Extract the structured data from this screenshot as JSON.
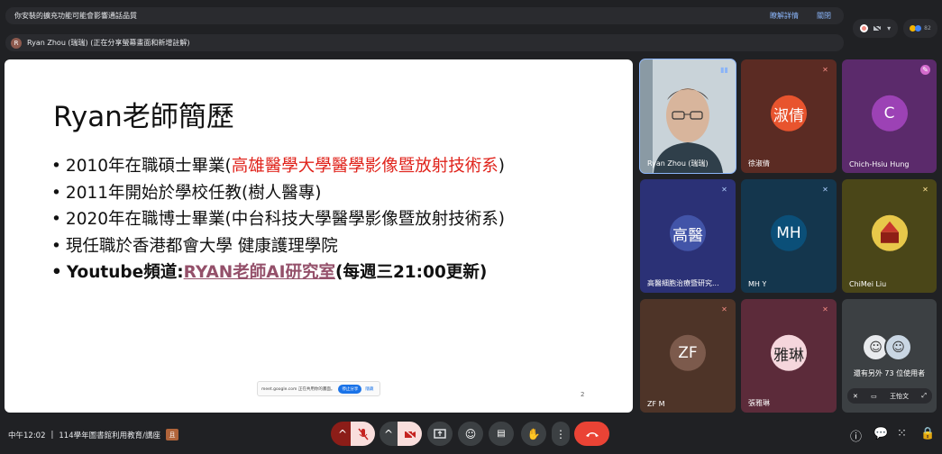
{
  "banner": {
    "text": "你安裝的擴充功能可能會影響通話品質",
    "learn_more": "瞭解詳情",
    "close": "關閉"
  },
  "share_bar": {
    "avatar_letter": "R",
    "text": "Ryan Zhou (瑞瑞) (正在分享螢幕畫面和新增註解)"
  },
  "top_right": {
    "people_count": "82"
  },
  "slide": {
    "title": "Ryan老師簡歷",
    "bullets": [
      {
        "prefix": "2010年在職碩士畢業(",
        "red": "高雄醫學大學醫學影像暨放射技術系",
        "suffix": ")"
      },
      {
        "text": "2011年開始於學校任教(樹人醫專)"
      },
      {
        "text": "2020年在職博士畢業(中台科技大學醫學影像暨放射技術系)"
      },
      {
        "text": "現任職於香港都會大學  健康護理學院"
      },
      {
        "prefix": "Youtube頻道:",
        "link": "RYAN老師AI研究室",
        "suffix": "(每週三21:00更新)"
      }
    ],
    "page_number": "2",
    "popup": {
      "text": "meet.google.com 正在共用你的畫面。",
      "stop": "停止分享",
      "hide": "隱藏"
    }
  },
  "participants": [
    {
      "name": "Ryan Zhou (瑞瑞)",
      "bg": "#b8c4cc",
      "speaking": true
    },
    {
      "name": "徐淑倩",
      "initials": "淑倩",
      "bg": "#5b2b23",
      "av": "#e8542e"
    },
    {
      "name": "Chich-Hsiu Hung",
      "initials": "C",
      "bg": "#5b2a6b",
      "av": "#9c42b5"
    },
    {
      "name": "高醫細胞治療暨研究...",
      "initials": "高醫",
      "bg": "#2b3176",
      "av": "#4254a8"
    },
    {
      "name": "MH Y",
      "initials": "MH",
      "bg": "#14364d",
      "av": "#0b4f78"
    },
    {
      "name": "ChiMei Liu",
      "bg": "#4a4618",
      "av": "#e8c84a"
    },
    {
      "name": "ZF M",
      "initials": "ZF",
      "bg": "#4e3428",
      "av": "#7c5a4c"
    },
    {
      "name": "張雅琳",
      "initials": "雅琳",
      "bg": "#5c2b3a",
      "av": "#f5d6dc"
    }
  ],
  "others": {
    "text": "還有另外 73 位使用者",
    "featured_name": "王怡文"
  },
  "bottom": {
    "time": "中午12:02",
    "separator": "|",
    "meeting_title": "114學年圖書館利用教育/講座",
    "cal_icon_text": "且"
  }
}
